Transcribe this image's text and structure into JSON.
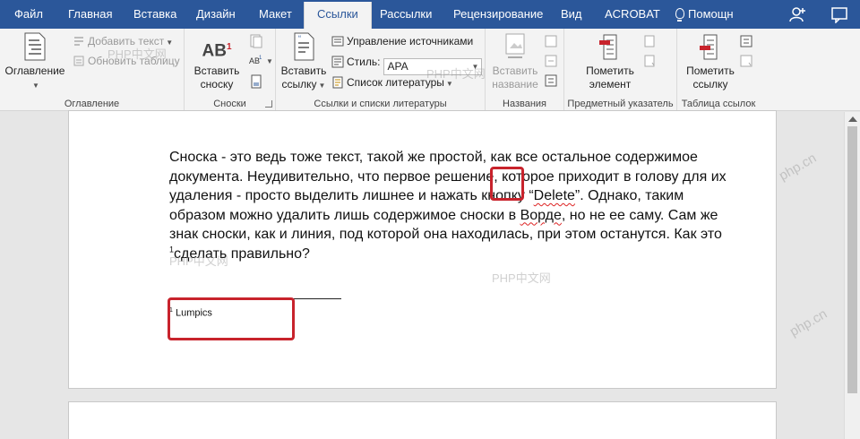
{
  "tabs": [
    "Файл",
    "Главная",
    "Вставка",
    "Дизайн",
    "Макет",
    "Ссылки",
    "Рассылки",
    "Рецензирование",
    "Вид",
    "ACROBAT",
    "Помощн"
  ],
  "active_tab": "Ссылки",
  "ribbon": {
    "toc": {
      "button": "Оглавление",
      "add_text": "Добавить текст",
      "update_table": "Обновить таблицу",
      "label": "Оглавление"
    },
    "footnotes": {
      "insert_button_line1": "Вставить",
      "insert_button_line2": "сноску",
      "icon_text": "AB",
      "icon_sup": "1",
      "label": "Сноски"
    },
    "citations": {
      "insert_line1": "Вставить",
      "insert_line2": "ссылку",
      "manage_sources": "Управление источниками",
      "style_label": "Стиль:",
      "style_value": "APA",
      "bibliography": "Список литературы",
      "label": "Ссылки и списки литературы"
    },
    "captions": {
      "insert_line1": "Вставить",
      "insert_line2": "название",
      "label": "Названия"
    },
    "index": {
      "mark_line1": "Пометить",
      "mark_line2": "элемент",
      "label": "Предметный указатель"
    },
    "toa": {
      "mark_line1": "Пометить",
      "mark_line2": "ссылку",
      "label": "Таблица ссылок"
    }
  },
  "document": {
    "p1": "Сноска - это ведь тоже текст, такой же простой, как все остальное содержимое документа. Неудивительно, что первое решение, которое приходит в голову для их удаления - просто выделить лишнее и нажать кнопку “",
    "delete_word": "Delete",
    "p2": "”. Однако, таким образом можно удалить лишь содержимое сноски в ",
    "vorde_word": "Ворде",
    "p3": ", но не ее саму. Сам же знак сноски, как и линия, под которой она находилась, при этом останутся. Как это ",
    "fn_mark": "1",
    "p4": "сделать правильно?",
    "footnote_number": "1",
    "footnote_text": "Lumpics"
  },
  "watermarks": [
    "PHP中文网",
    "PHP中文网",
    "PHP中文网",
    "PHP中文网",
    "php.cn",
    "php.cn"
  ],
  "colors": {
    "tabbar": "#2b579a",
    "ribbon": "#f3f3f3",
    "highlight": "#c8232c"
  }
}
